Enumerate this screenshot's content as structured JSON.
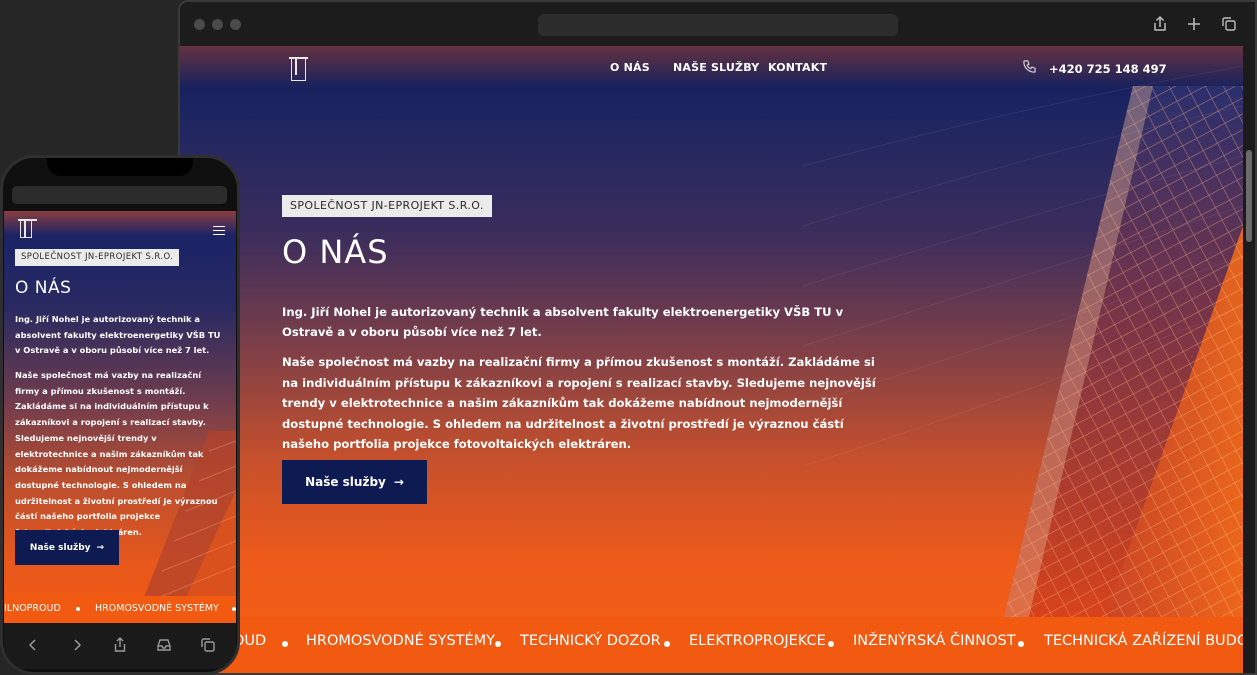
{
  "nav": {
    "links": [
      "O NÁS",
      "NAŠE SLUŽBY",
      "KONTAKT"
    ],
    "phone": "+420 725 148 497"
  },
  "hero": {
    "tag": "SPOLEČNOST JN-EPROJEKT S.R.O.",
    "title": "O NÁS",
    "paragraph1": "Ing. Jiří Nohel je autorizovaný technik a absolvent fakulty elektroenergetiky VŠB TU v Ostravě a v oboru působí více než 7 let.",
    "paragraph2": "Naše společnost má vazby na realizační firmy a přímou zkušenost s montáží. Zakládáme si na individuálním přístupu k zákazníkovi a ropojení s realizací stavby. Sledujeme nejnovější trendy v elektrotechnice a našim zákazníkům tak dokážeme nabídnout nejmodernější dostupné technologie. S ohledem na udržitelnost a životní prostředí je výraznou částí našeho portfolia projekce fotovoltaických elektráren.",
    "cta_label": "Naše služby",
    "cta_arrow": "→"
  },
  "marquee": {
    "desktop": [
      "OUD",
      "HROMOSVODNÉ SYSTÉMY",
      "TECHNICKÝ DOZOR",
      "ELEKTROPROJEKCE",
      "INŽENÝRSKÁ ČINNOST",
      "TECHNICKÁ ZAŘÍZENÍ BUDOV"
    ],
    "mobile": [
      "ILNOPROUD",
      "HROMOSVODNÉ SYSTÉMY"
    ]
  },
  "icons": {
    "phone": "phone-icon",
    "share": "share-icon",
    "new_tab": "plus-icon",
    "tabs": "tabs-icon",
    "back": "chevron-left-icon",
    "forward": "chevron-right-icon",
    "bookmarks": "inbox-icon",
    "menu": "hamburger-icon"
  },
  "colors": {
    "cta_bg": "#0e1a52",
    "marquee_bg": "#f25a12",
    "tag_bg": "#ebebeb"
  }
}
